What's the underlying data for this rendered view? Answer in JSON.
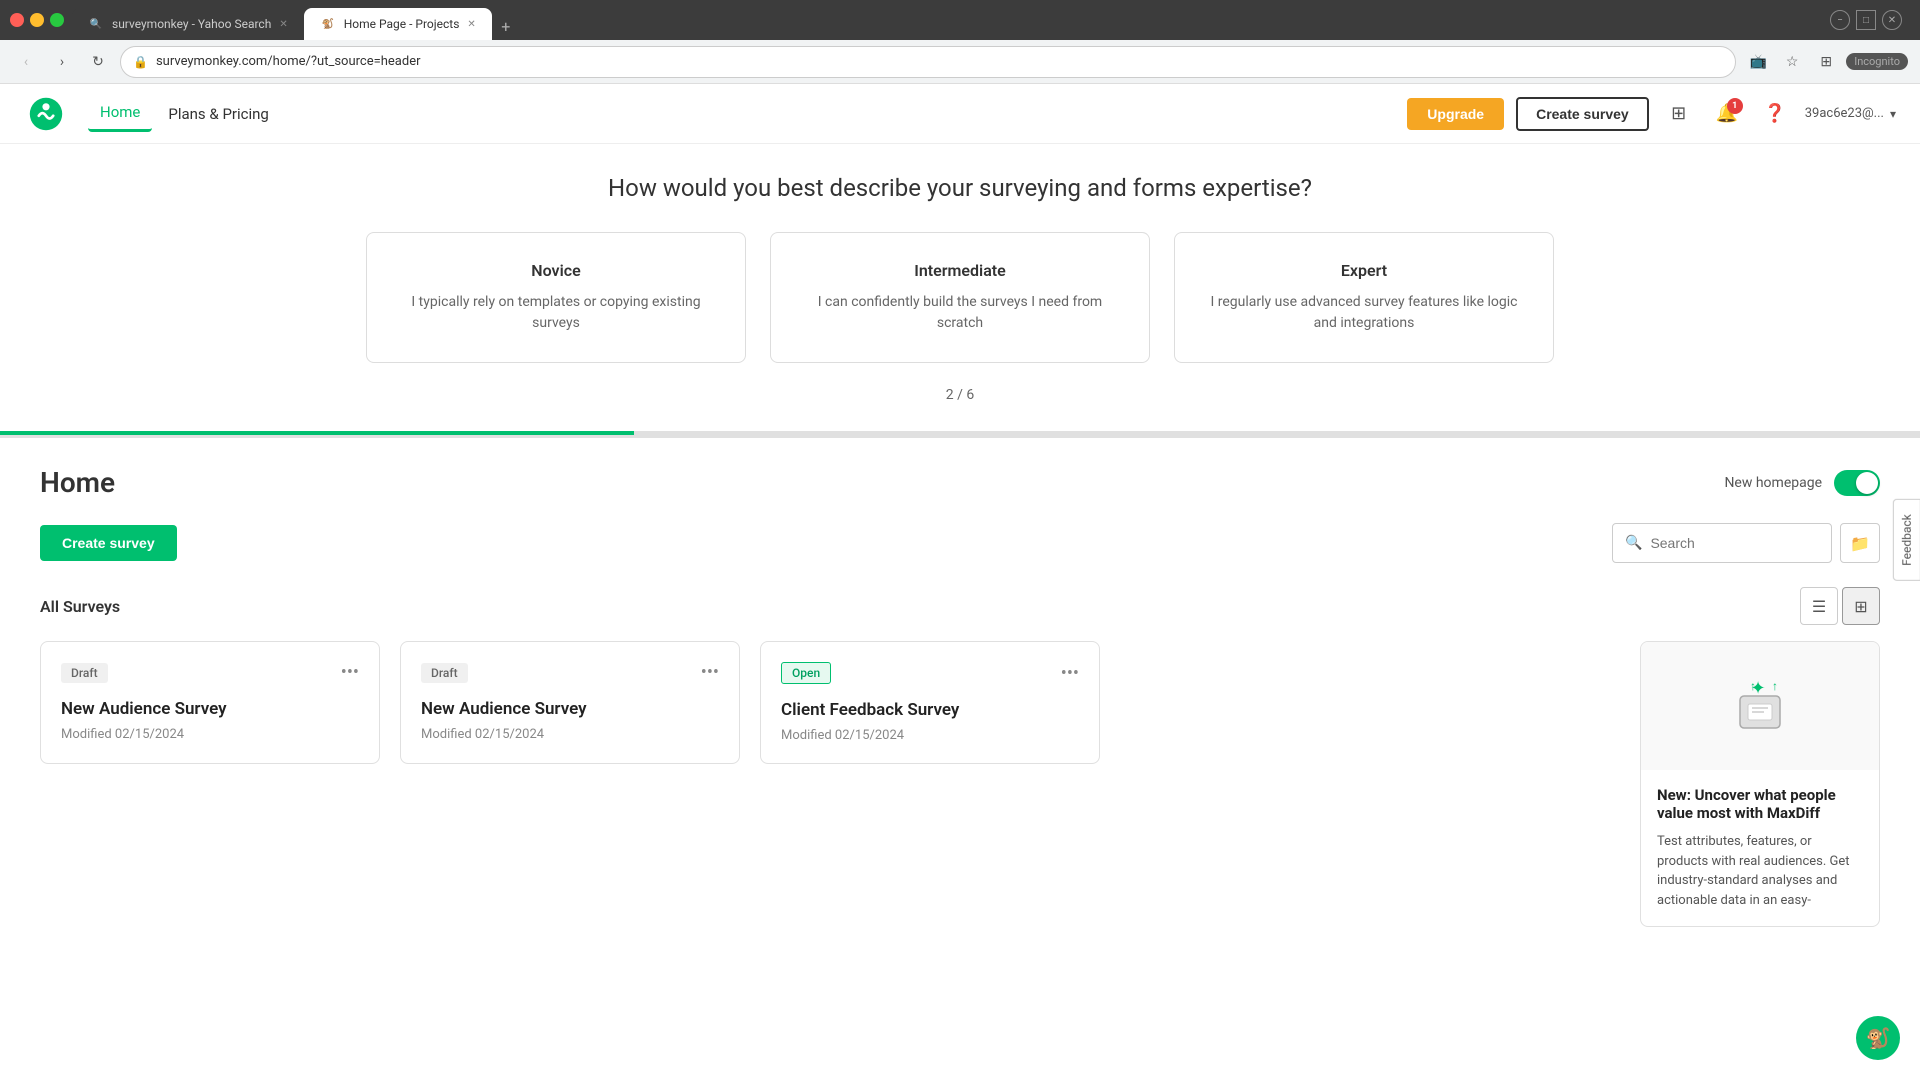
{
  "browser": {
    "tabs": [
      {
        "id": "tab1",
        "title": "surveymonkey - Yahoo Search",
        "favicon": "🔍",
        "active": false
      },
      {
        "id": "tab2",
        "title": "Home Page - Projects",
        "favicon": "🐒",
        "active": true
      }
    ],
    "address": "surveymonkey.com/home/?ut_source=header",
    "new_tab_label": "+",
    "incognito_label": "Incognito"
  },
  "nav": {
    "home_label": "Home",
    "plans_pricing_label": "Plans & Pricing",
    "upgrade_label": "Upgrade",
    "create_survey_label": "Create survey",
    "notification_count": "1",
    "user_email": "39ac6e23@...",
    "apps_icon": "apps",
    "bell_icon": "bell",
    "help_icon": "help",
    "user_arrow": "▾"
  },
  "expertise": {
    "title": "How would you best describe your surveying and forms expertise?",
    "cards": [
      {
        "id": "novice",
        "title": "Novice",
        "description": "I typically rely on templates or copying existing surveys"
      },
      {
        "id": "intermediate",
        "title": "Intermediate",
        "description": "I can confidently build the surveys I need from scratch"
      },
      {
        "id": "expert",
        "title": "Expert",
        "description": "I regularly use advanced survey features like logic and integrations"
      }
    ],
    "progress_text": "2 / 6"
  },
  "home": {
    "title": "Home",
    "new_homepage_label": "New homepage",
    "create_survey_label": "Create survey",
    "search_placeholder": "Search",
    "all_surveys_label": "All Surveys",
    "toggle_list_icon": "☰",
    "toggle_grid_icon": "⊞",
    "folder_icon": "📁"
  },
  "surveys": [
    {
      "id": "survey1",
      "badge": "Draft",
      "badge_type": "draft",
      "title": "New Audience Survey",
      "modified": "Modified 02/15/2024"
    },
    {
      "id": "survey2",
      "badge": "Draft",
      "badge_type": "draft",
      "title": "New Audience Survey",
      "modified": "Modified 02/15/2024"
    },
    {
      "id": "survey3",
      "badge": "Open",
      "badge_type": "open",
      "title": "Client Feedback Survey",
      "modified": "Modified 02/15/2024"
    }
  ],
  "side_panel": {
    "title": "New: Uncover what people value most with MaxDiff",
    "description": "Test attributes, features, or products with real audiences. Get industry-standard analyses and actionable data in an easy-"
  },
  "feedback_btn": "Feedback"
}
